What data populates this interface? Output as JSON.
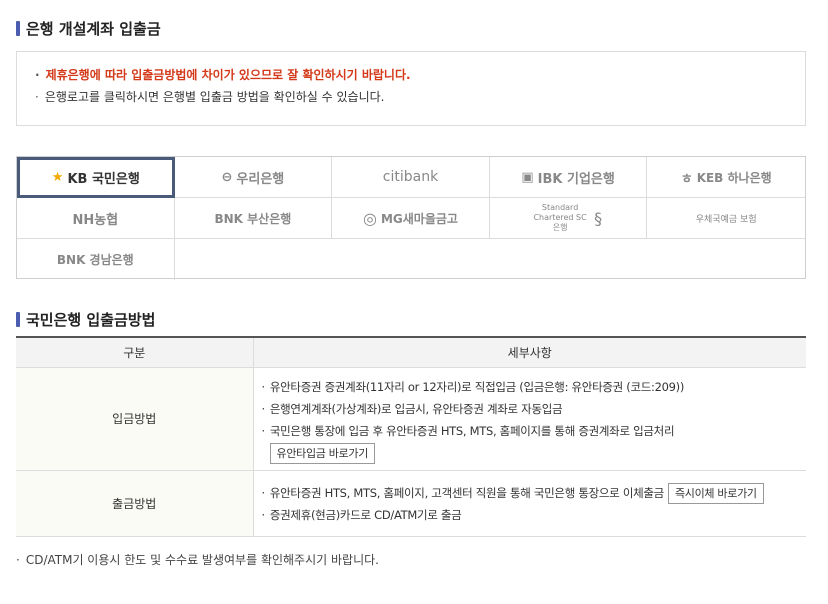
{
  "section1": {
    "title": "은행 개설계좌 입출금"
  },
  "notices": [
    "제휴은행에 따라 입출금방법에 차이가 있으므로 잘 확인하시기 바랍니다.",
    "은행로고를 클릭하시면 은행별 입출금 방법을 확인하실 수 있습니다."
  ],
  "banks": [
    {
      "label": "KB 국민은행",
      "icon": "★"
    },
    {
      "label": "우리은행",
      "icon": "⊖"
    },
    {
      "label": "citibank",
      "icon": ""
    },
    {
      "label": "IBK 기업은행",
      "icon": "▣"
    },
    {
      "label": "KEB 하나은행",
      "icon": "ㅎ"
    },
    {
      "label": "NH농협",
      "icon": ""
    },
    {
      "label": "BNK 부산은행",
      "icon": ""
    },
    {
      "label": "MG새마을금고",
      "icon": "◎"
    },
    {
      "label": "Standard Chartered SC은행",
      "icon": "§"
    },
    {
      "label": "우체국예금 보험",
      "icon": ""
    },
    {
      "label": "BNK 경남은행",
      "icon": ""
    }
  ],
  "section2": {
    "title": "국민은행 입출금방법"
  },
  "table": {
    "headers": [
      "구분",
      "세부사항"
    ],
    "deposit": {
      "label": "입금방법",
      "lines": [
        "유안타증권 증권계좌(11자리 or 12자리)로 직접입금 (입금은행: 유안타증권 (코드:209))",
        "은행연계계좌(가상계좌)로 입금시, 유안타증권 계좌로 자동입금",
        "국민은행 통장에 입금 후 유안타증권 HTS, MTS, 홈페이지를 통해 증권계좌로 입금처리"
      ],
      "button": "유안타입금 바로가기"
    },
    "withdraw": {
      "label": "출금방법",
      "lines": [
        "유안타증권 HTS, MTS, 홈페이지, 고객센터 직원을 통해 국민은행 통장으로 이체출금",
        "증권제휴(현금)카드로 CD/ATM기로 출금"
      ],
      "button": "즉시이체 바로가기"
    }
  },
  "footer": "CD/ATM기 이용시 한도 및 수수료 발생여부를 확인해주시기 바랍니다."
}
